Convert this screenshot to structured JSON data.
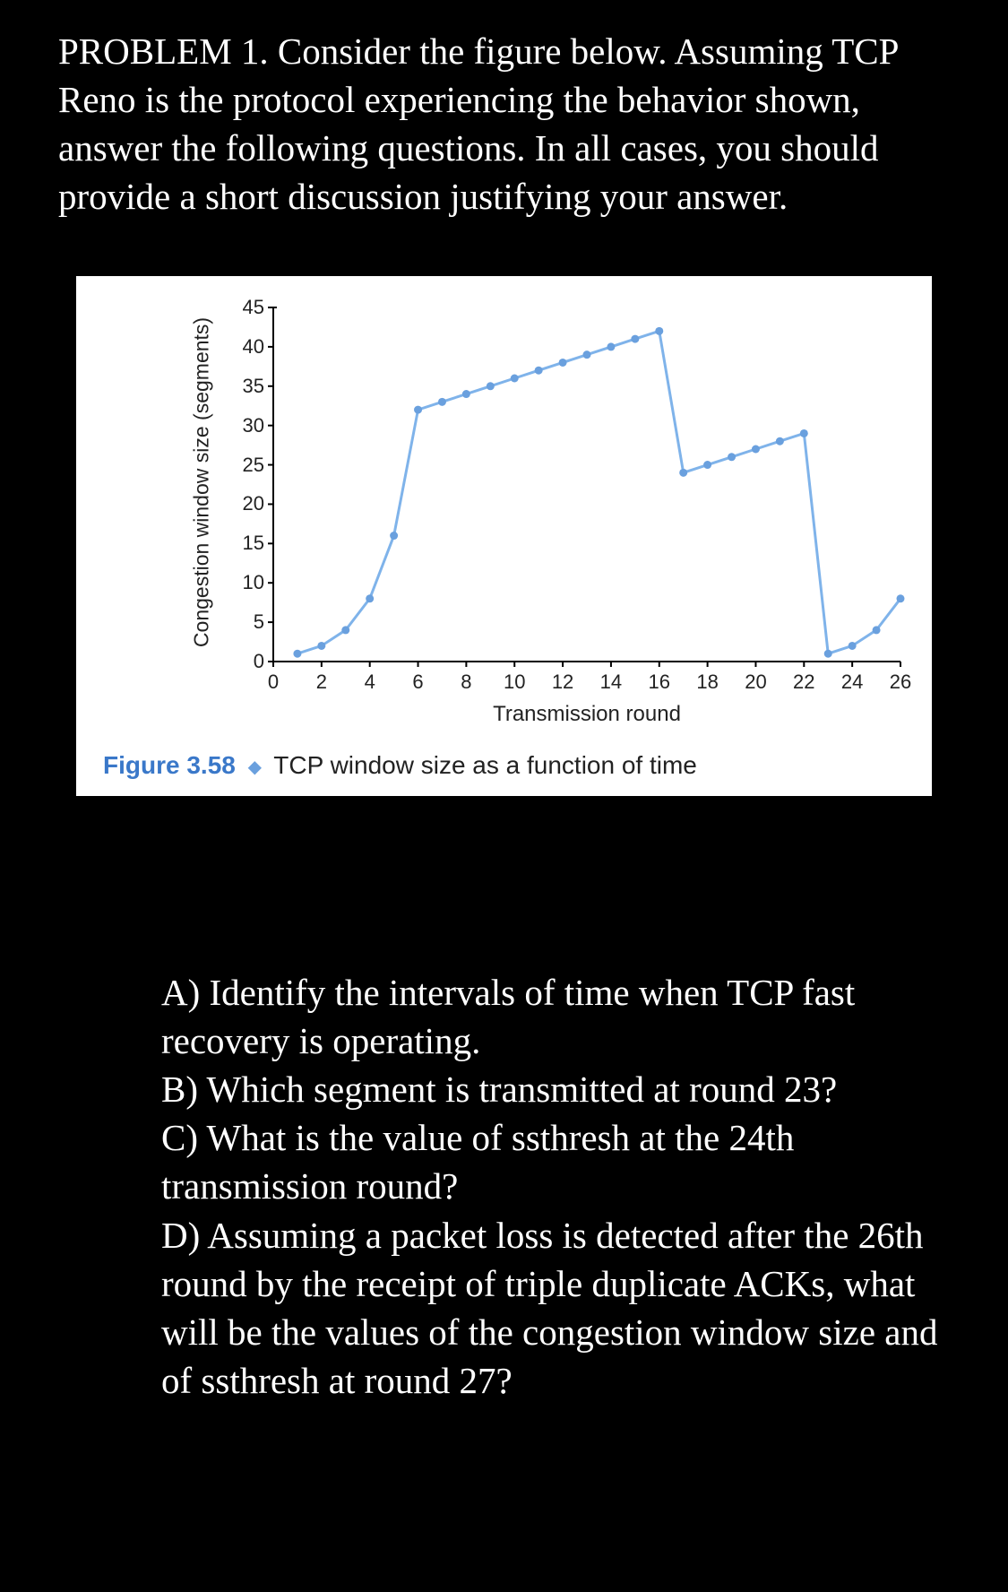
{
  "problem": {
    "heading": "PROBLEM 1. Consider the figure below. Assuming TCP Reno is the protocol experiencing the behavior shown, answer the following questions. In all cases, you should provide a short discussion justifying your answer."
  },
  "figure": {
    "fignum": "Figure 3.58",
    "caption_text": "TCP window size as a function of time",
    "xlabel": "Transmission round",
    "ylabel": "Congestion window size (segments)"
  },
  "chart_data": {
    "type": "line",
    "x": [
      1,
      2,
      3,
      4,
      5,
      6,
      7,
      8,
      9,
      10,
      11,
      12,
      13,
      14,
      15,
      16,
      17,
      18,
      19,
      20,
      21,
      22,
      23,
      24,
      25,
      26
    ],
    "values": [
      1,
      2,
      4,
      8,
      16,
      32,
      33,
      34,
      35,
      36,
      37,
      38,
      39,
      40,
      41,
      42,
      24,
      25,
      26,
      27,
      28,
      29,
      1,
      2,
      4,
      8
    ],
    "xlabel": "Transmission round",
    "ylabel": "Congestion window size (segments)",
    "xlim": [
      0,
      26
    ],
    "ylim": [
      0,
      45
    ],
    "xticks": [
      0,
      2,
      4,
      6,
      8,
      10,
      12,
      14,
      16,
      18,
      20,
      22,
      24,
      26
    ],
    "yticks": [
      0,
      5,
      10,
      15,
      20,
      25,
      30,
      35,
      40,
      45
    ]
  },
  "questions": {
    "a": "A) Identify the intervals of time when TCP fast recovery is operating.",
    "b": "B) Which segment is transmitted at round 23?",
    "c": "C) What is the value of ssthresh at the 24th transmission round?",
    "d": "D) Assuming a packet loss is detected after the 26th round by the receipt of triple duplicate ACKs, what will be the values of the congestion window size and of ssthresh at round 27?"
  }
}
